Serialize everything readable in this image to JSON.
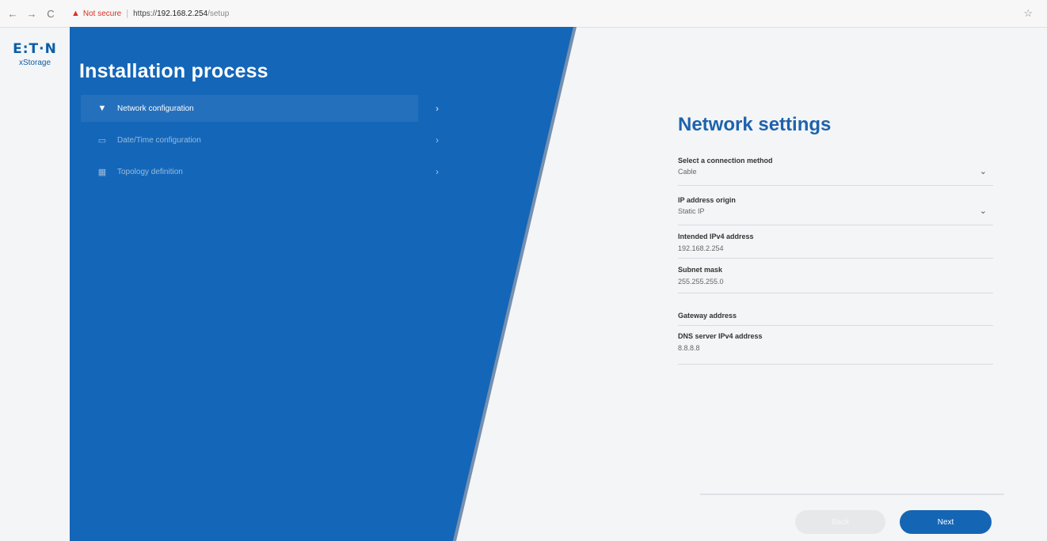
{
  "browser": {
    "back_glyph": "←",
    "forward_glyph": "→",
    "reload_glyph": "C",
    "warning_glyph": "▲",
    "not_secure": "Not secure",
    "url_scheme": "https://",
    "url_host": "192.168.2.254",
    "url_path": "/setup",
    "star_glyph": "☆"
  },
  "brand": {
    "logo_text": "E:T·N",
    "product": "xStorage"
  },
  "sidebar": {
    "title": "Installation process",
    "steps": [
      {
        "label": "Network configuration",
        "icon": "wifi-icon",
        "glyph": "▼",
        "active": true
      },
      {
        "label": "Date/Time configuration",
        "icon": "calendar-icon",
        "glyph": "▭",
        "active": false
      },
      {
        "label": "Topology definition",
        "icon": "grid-icon",
        "glyph": "▦",
        "active": false
      }
    ],
    "chevron_glyph": "›"
  },
  "form": {
    "title": "Network settings",
    "connection_method": {
      "label": "Select a connection method",
      "value": "Cable"
    },
    "ip_origin": {
      "label": "IP address origin",
      "value": "Static IP"
    },
    "ipv4": {
      "label": "Intended IPv4 address",
      "value": "192.168.2.254"
    },
    "subnet": {
      "label": "Subnet mask",
      "value": "255.255.255.0"
    },
    "gateway": {
      "label": "Gateway address",
      "value": ""
    },
    "dns": {
      "label": "DNS server IPv4 address",
      "value": "8.8.8.8"
    },
    "dropdown_glyph": "⌄"
  },
  "buttons": {
    "back": "Back",
    "next": "Next"
  },
  "colors": {
    "brand_blue": "#1565b5",
    "panel_blue": "#1466b8",
    "dark_strip": "#0f3c73"
  }
}
